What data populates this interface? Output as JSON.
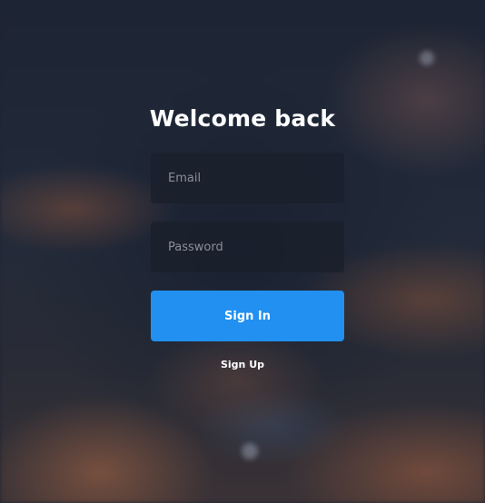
{
  "login": {
    "title": "Welcome back",
    "email": {
      "placeholder": "Email",
      "value": ""
    },
    "password": {
      "placeholder": "Password",
      "value": ""
    },
    "sign_in_label": "Sign In",
    "sign_up_label": "Sign Up"
  },
  "theme": {
    "accent": "#2190f0",
    "field_background": "#1a1f2a",
    "text": "#ffffff"
  }
}
